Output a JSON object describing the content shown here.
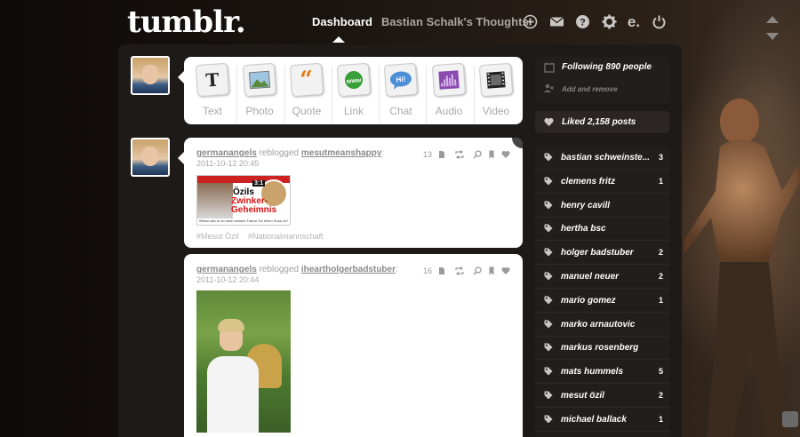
{
  "header": {
    "logo": "tumblr.",
    "nav_dashboard": "Dashboard",
    "nav_blog": "Bastian Schalk's Thoughts",
    "icons": [
      "plus-icon",
      "mail-icon",
      "help-icon",
      "gear-icon",
      "e-icon",
      "power-icon"
    ]
  },
  "post_types": [
    {
      "label": "Text",
      "icon": "text-icon"
    },
    {
      "label": "Photo",
      "icon": "photo-icon"
    },
    {
      "label": "Quote",
      "icon": "quote-icon"
    },
    {
      "label": "Link",
      "icon": "link-icon"
    },
    {
      "label": "Chat",
      "icon": "chat-icon"
    },
    {
      "label": "Audio",
      "icon": "audio-icon"
    },
    {
      "label": "Video",
      "icon": "video-icon"
    }
  ],
  "posts": [
    {
      "user": "germanangels",
      "action": "reblogged",
      "source": "mesutmeanshappy",
      "date": "2011-10-12 20:45",
      "notes": "13",
      "image_text": {
        "score": "3:1",
        "line1": "Özils",
        "line2": "Zwinker-",
        "line3": "Geheimnis",
        "small": "Wieso sah er so nach seinem Traum-Tor einen Kuss zu?"
      },
      "tags": [
        "#Mesut Özil",
        "#Nationalmannschaft"
      ]
    },
    {
      "user": "germanangels",
      "action": "reblogged",
      "source": "iheartholgerbadstuber",
      "date": "2011-10-12 20:44",
      "notes": "16"
    }
  ],
  "sidebar": {
    "following": "Following 890 people",
    "add_remove": "Add and remove",
    "liked": "Liked 2,158 posts",
    "tags": [
      {
        "name": "bastian schweinste...",
        "count": "3"
      },
      {
        "name": "clemens fritz",
        "count": "1"
      },
      {
        "name": "henry cavill",
        "count": ""
      },
      {
        "name": "hertha bsc",
        "count": ""
      },
      {
        "name": "holger badstuber",
        "count": "2"
      },
      {
        "name": "manuel neuer",
        "count": "2"
      },
      {
        "name": "mario gomez",
        "count": "1"
      },
      {
        "name": "marko arnautovic",
        "count": ""
      },
      {
        "name": "markus rosenberg",
        "count": ""
      },
      {
        "name": "mats hummels",
        "count": "5"
      },
      {
        "name": "mesut özil",
        "count": "2"
      },
      {
        "name": "michael ballack",
        "count": "1"
      }
    ]
  },
  "colors": {
    "background": "#120d0a",
    "panel": "#1e1a17",
    "card": "#ffffff",
    "tag_panel": "#221e1b"
  }
}
